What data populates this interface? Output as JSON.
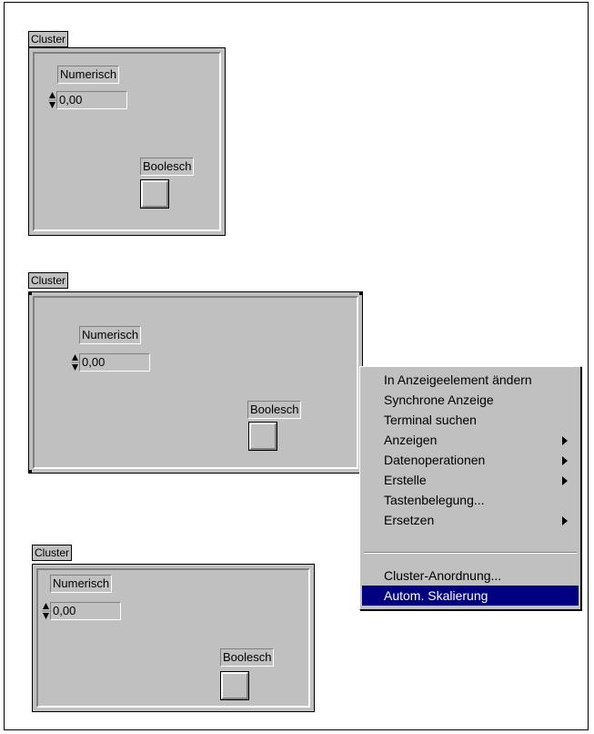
{
  "clusters": [
    {
      "label": "Cluster",
      "numeric_label": "Numerisch",
      "numeric_value": "0,00",
      "boolean_label": "Boolesch"
    },
    {
      "label": "Cluster",
      "numeric_label": "Numerisch",
      "numeric_value": "0,00",
      "boolean_label": "Boolesch"
    },
    {
      "label": "Cluster",
      "numeric_label": "Numerisch",
      "numeric_value": "0,00",
      "boolean_label": "Boolesch"
    }
  ],
  "context_menu": {
    "items": [
      {
        "label": "In Anzeigeelement ändern",
        "submenu": false
      },
      {
        "label": "Synchrone Anzeige",
        "submenu": false
      },
      {
        "label": "Terminal suchen",
        "submenu": false
      },
      {
        "label": "Anzeigen",
        "submenu": true
      },
      {
        "label": "Datenoperationen",
        "submenu": true
      },
      {
        "label": "Erstelle",
        "submenu": true
      },
      {
        "label": "Tastenbelegung...",
        "submenu": false
      },
      {
        "label": "Ersetzen",
        "submenu": true
      }
    ],
    "items_bottom": [
      {
        "label": "Cluster-Anordnung...",
        "submenu": false
      },
      {
        "label": "Autom. Skalierung",
        "submenu": false,
        "selected": true
      }
    ]
  },
  "colors": {
    "panel": "#c0c0c0",
    "highlight": "#000080"
  }
}
